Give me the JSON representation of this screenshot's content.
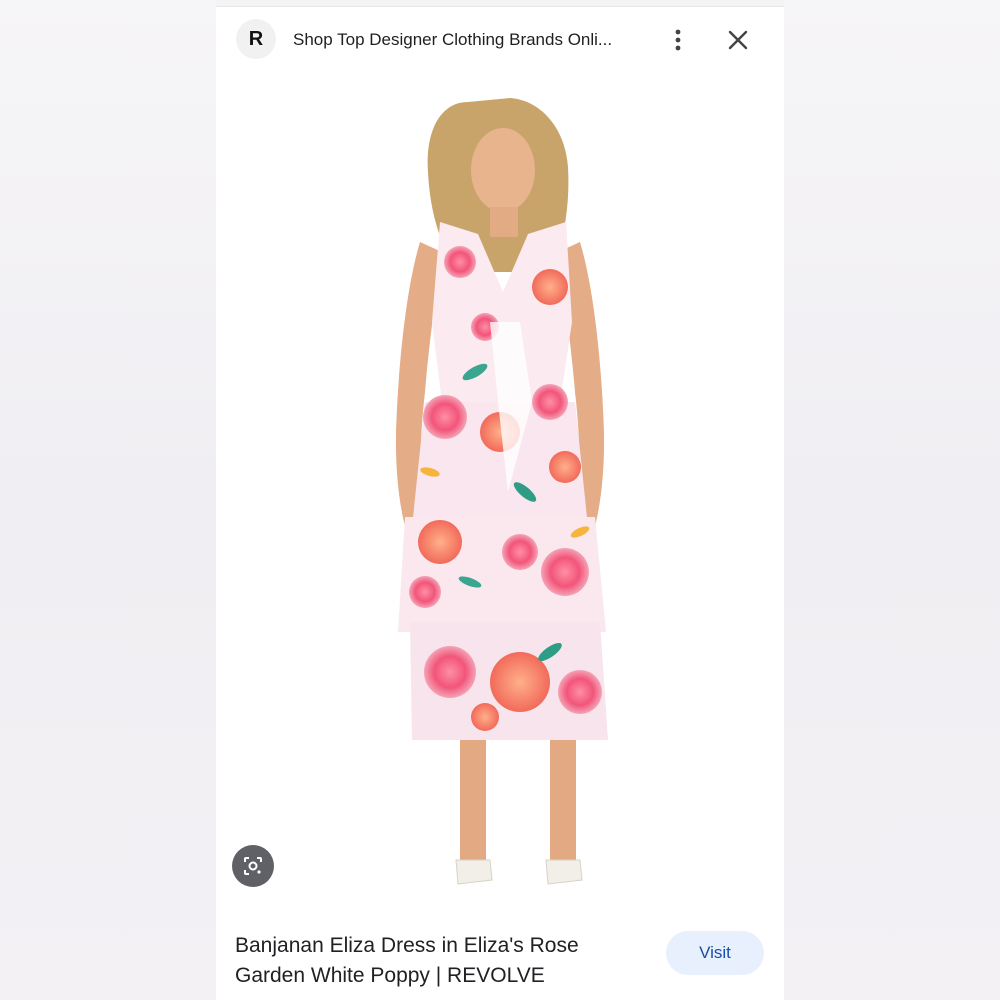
{
  "header": {
    "favicon_letter": "R",
    "site_title": "Shop Top Designer Clothing Brands Onli..."
  },
  "image": {
    "subject": "product-photo-woman-floral-tiered-dress"
  },
  "footer": {
    "caption": "Banjanan Eliza Dress in Eliza's Rose Garden White Poppy | REVOLVE",
    "visit_label": "Visit"
  },
  "icons": {
    "menu": "more-vert-icon",
    "close": "close-icon",
    "lens": "google-lens-icon"
  },
  "colors": {
    "visit_bg": "#e8f0fe",
    "visit_text": "#174ea6",
    "lens_bg": "#5f6166"
  }
}
